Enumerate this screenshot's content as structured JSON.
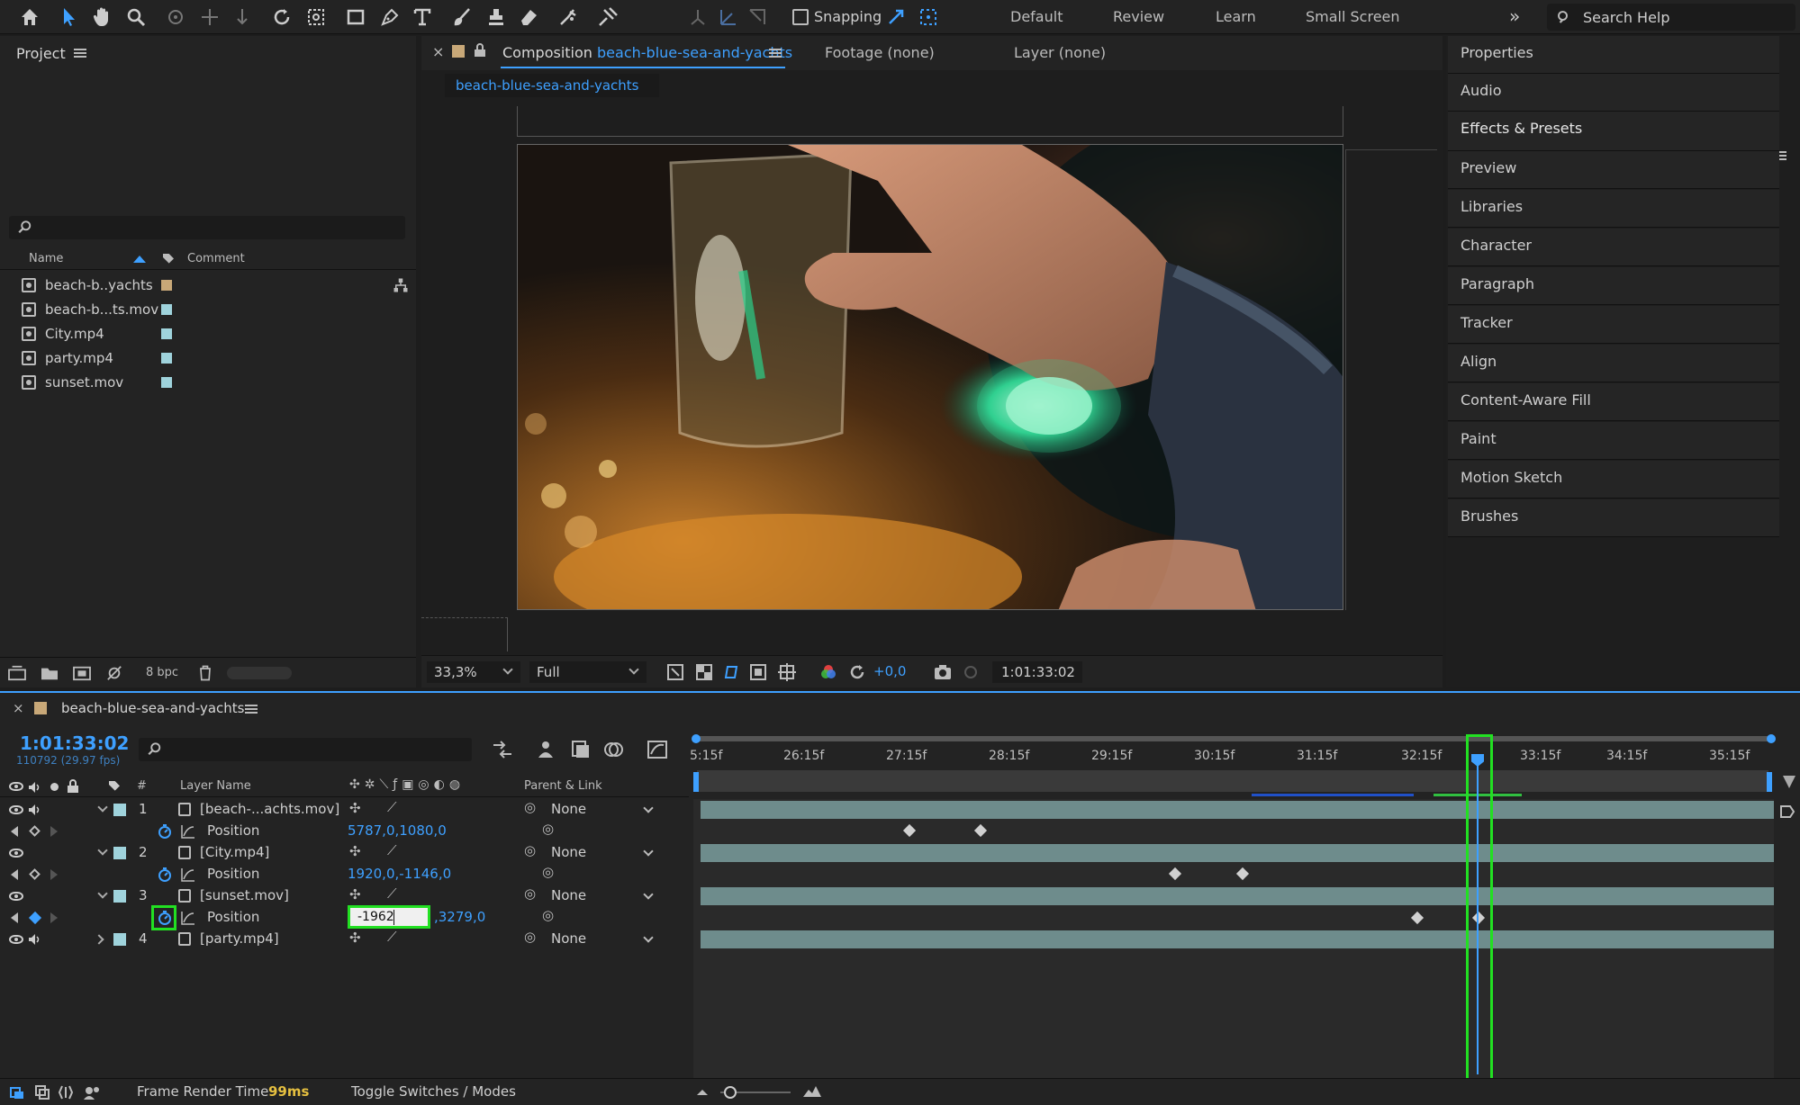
{
  "toolbar": {
    "snapping_label": "Snapping",
    "workspaces": [
      "Default",
      "Review",
      "Learn",
      "Small Screen"
    ],
    "search_placeholder": "Search Help"
  },
  "project": {
    "title": "Project",
    "col_name": "Name",
    "col_comment": "Comment",
    "items": [
      {
        "name": "beach-b..yachts",
        "color": "#c8a878"
      },
      {
        "name": "beach-b...ts.mov",
        "color": "#9fd3dc"
      },
      {
        "name": "City.mp4",
        "color": "#9fd3dc"
      },
      {
        "name": "party.mp4",
        "color": "#9fd3dc"
      },
      {
        "name": "sunset.mov",
        "color": "#9fd3dc"
      }
    ],
    "bpc": "8 bpc"
  },
  "viewer": {
    "tab_composition": "Composition",
    "comp_name": "beach-blue-sea-and-yachts",
    "tab_footage": "Footage (none)",
    "tab_layer": "Layer (none)",
    "subtab": "beach-blue-sea-and-yachts",
    "zoom": "33,3%",
    "resolution": "Full",
    "exposure": "+0,0",
    "timecode": "1:01:33:02"
  },
  "right_panel": {
    "items": [
      "Properties",
      "Audio",
      "Effects & Presets",
      "Preview",
      "Libraries",
      "Character",
      "Paragraph",
      "Tracker",
      "Align",
      "Content-Aware Fill",
      "Paint",
      "Motion Sketch",
      "Brushes"
    ]
  },
  "timeline": {
    "comp_name": "beach-blue-sea-and-yachts",
    "timecode": "1:01:33:02",
    "frame_info": "110792 (29.97 fps)",
    "col_hash": "#",
    "col_layer_name": "Layer Name",
    "col_parent": "Parent & Link",
    "ticks": [
      "5:15f",
      "26:15f",
      "27:15f",
      "28:15f",
      "29:15f",
      "30:15f",
      "31:15f",
      "32:15f",
      "33:15f",
      "34:15f",
      "35:15f"
    ],
    "layers": [
      {
        "num": "1",
        "name": "[beach-...achts.mov]",
        "parent": "None",
        "prop": "Position",
        "value": "5787,0,1080,0"
      },
      {
        "num": "2",
        "name": "[City.mp4]",
        "parent": "None",
        "prop": "Position",
        "value": "1920,0,-1146,0"
      },
      {
        "num": "3",
        "name": "[sunset.mov]",
        "parent": "None",
        "prop": "Position",
        "value_x": "-1962",
        "value_y": ",3279,0"
      },
      {
        "num": "4",
        "name": "[party.mp4]",
        "parent": "None"
      }
    ],
    "footer_render_label": "Frame Render Time",
    "footer_render_value": "99ms",
    "footer_toggle": "Toggle Switches / Modes"
  }
}
